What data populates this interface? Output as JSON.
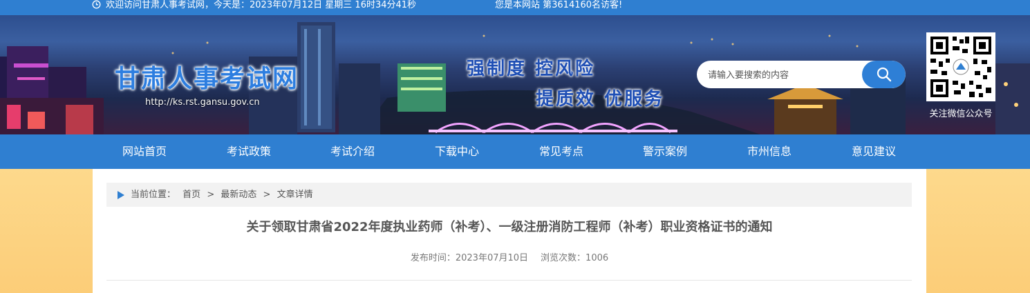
{
  "topbar": {
    "welcome": "欢迎访问甘肃人事考试网，今天是：2023年07月12日 星期三 16时34分41秒",
    "visitor": "您是本网站 第3614160名访客!"
  },
  "banner": {
    "site_title": "甘肃人事考试网",
    "site_url": "http://ks.rst.gansu.gov.cn",
    "slogan_line1": "强制度  控风险",
    "slogan_line2": "提质效  优服务",
    "search_placeholder": "请输入要搜索的内容",
    "qr_caption": "关注微信公众号"
  },
  "nav": {
    "items": [
      {
        "label": "网站首页"
      },
      {
        "label": "考试政策"
      },
      {
        "label": "考试介绍"
      },
      {
        "label": "下载中心"
      },
      {
        "label": "常见考点"
      },
      {
        "label": "警示案例"
      },
      {
        "label": "市州信息"
      },
      {
        "label": "意见建议"
      }
    ]
  },
  "breadcrumb": {
    "prefix": "当前位置：",
    "items": [
      "首页",
      "最新动态",
      "文章详情"
    ],
    "separator": ">"
  },
  "article": {
    "title": "关于领取甘肃省2022年度执业药师（补考）、一级注册消防工程师（补考）职业资格证书的通知",
    "publish_label": "发布时间：",
    "publish_date": "2023年07月10日",
    "views_label": "浏览次数：",
    "views": "1006"
  },
  "colors": {
    "brand_blue": "#2f7fd1",
    "body_orange": "#fdd98c"
  }
}
